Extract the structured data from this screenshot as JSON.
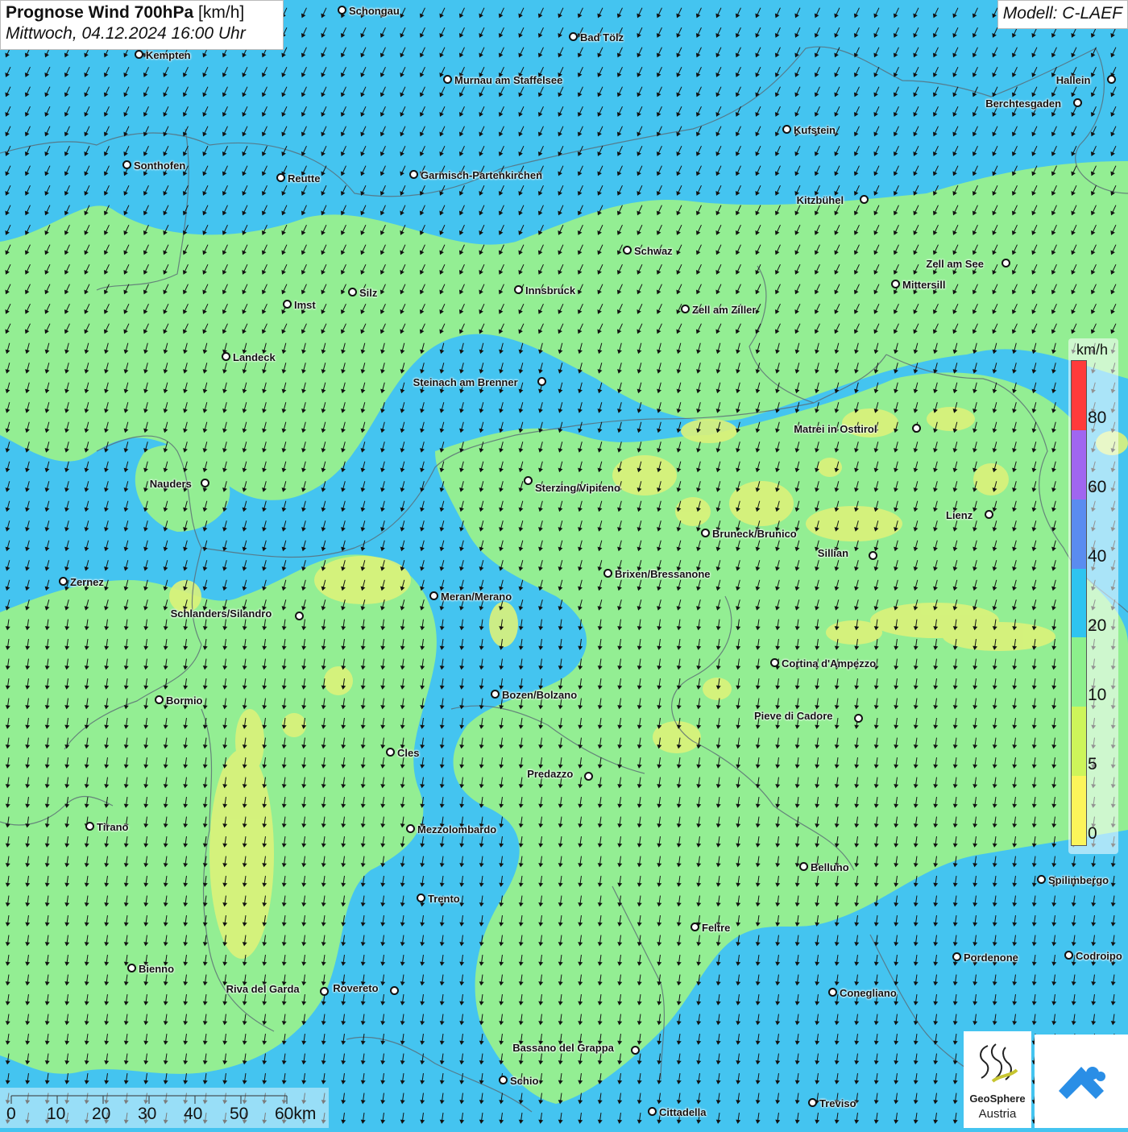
{
  "title": {
    "main": "Prognose Wind 700hPa",
    "unit": "[km/h]",
    "datetime": "Mittwoch, 04.12.2024 16:00 Uhr"
  },
  "model": "Modell: C-LAEF",
  "legend": {
    "unit": "km/h",
    "ticks": [
      "80",
      "60",
      "40",
      "20",
      "10",
      "5",
      "0"
    ],
    "colors": [
      "#ff3b3b",
      "#a066f0",
      "#5a8cf0",
      "#2ec4f0",
      "#8cf08c",
      "#cdf55a",
      "#fbf55a"
    ]
  },
  "scale": {
    "labels": [
      "0",
      "10",
      "20",
      "30",
      "40",
      "50",
      "60km"
    ]
  },
  "logos": {
    "geosphere_line1": "GeoSphere",
    "geosphere_line2": "Austria"
  },
  "cities": [
    {
      "name": "Schongau"
    },
    {
      "name": "Bad Tölz"
    },
    {
      "name": "Kempten"
    },
    {
      "name": "Murnau am Staffelsee"
    },
    {
      "name": "Hallein"
    },
    {
      "name": "Berchtesgaden"
    },
    {
      "name": "Kufstein"
    },
    {
      "name": "Sonthofen"
    },
    {
      "name": "Reutte"
    },
    {
      "name": "Garmisch-Partenkirchen"
    },
    {
      "name": "Kitzbühel"
    },
    {
      "name": "Schwaz"
    },
    {
      "name": "Zell am See"
    },
    {
      "name": "Mittersill"
    },
    {
      "name": "Innsbruck"
    },
    {
      "name": "Silz"
    },
    {
      "name": "Imst"
    },
    {
      "name": "Zell am Ziller"
    },
    {
      "name": "Landeck"
    },
    {
      "name": "Steinach am Brenner"
    },
    {
      "name": "Matrei in Osttirol"
    },
    {
      "name": "Nauders"
    },
    {
      "name": "Sterzing/Vipiteno"
    },
    {
      "name": "Lienz"
    },
    {
      "name": "Bruneck/Brunico"
    },
    {
      "name": "Sillian"
    },
    {
      "name": "Zernez"
    },
    {
      "name": "Brixen/Bressanone"
    },
    {
      "name": "Meran/Merano"
    },
    {
      "name": "Schlanders/Silandro"
    },
    {
      "name": "Cortina d'Ampezzo"
    },
    {
      "name": "Bozen/Bolzano"
    },
    {
      "name": "Bormio"
    },
    {
      "name": "Pieve di Cadore"
    },
    {
      "name": "Cles"
    },
    {
      "name": "Predazzo"
    },
    {
      "name": "Tirano"
    },
    {
      "name": "Mezzolombardo"
    },
    {
      "name": "Belluno"
    },
    {
      "name": "Spilimbergo"
    },
    {
      "name": "Trento"
    },
    {
      "name": "Feltre"
    },
    {
      "name": "Pordenone"
    },
    {
      "name": "Codroipo"
    },
    {
      "name": "Bienno"
    },
    {
      "name": "Riva del Garda"
    },
    {
      "name": "Rovereto"
    },
    {
      "name": "Conegliano"
    },
    {
      "name": "Bassano del Grappa"
    },
    {
      "name": "Schio"
    },
    {
      "name": "Treviso"
    },
    {
      "name": "Cittadella"
    }
  ]
}
